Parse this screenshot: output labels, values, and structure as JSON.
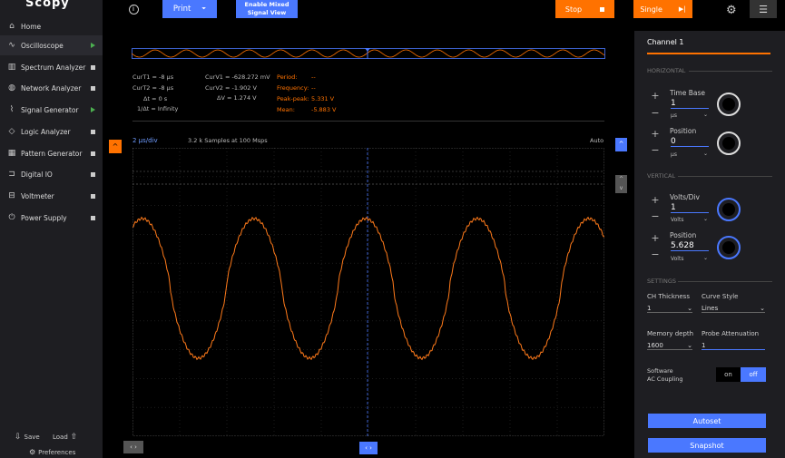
{
  "app": {
    "logo": "Scopy"
  },
  "sidebar": {
    "items": [
      {
        "label": "Home",
        "icon": "home-icon",
        "ind": "none"
      },
      {
        "label": "Oscilloscope",
        "icon": "oscilloscope-icon",
        "ind": "play"
      },
      {
        "label": "Spectrum Analyzer",
        "icon": "spectrum-icon",
        "ind": "square"
      },
      {
        "label": "Network Analyzer",
        "icon": "network-icon",
        "ind": "square"
      },
      {
        "label": "Signal Generator",
        "icon": "signal-icon",
        "ind": "play"
      },
      {
        "label": "Logic Analyzer",
        "icon": "logic-icon",
        "ind": "square"
      },
      {
        "label": "Pattern Generator",
        "icon": "pattern-icon",
        "ind": "square"
      },
      {
        "label": "Digital IO",
        "icon": "digital-io-icon",
        "ind": "square"
      },
      {
        "label": "Voltmeter",
        "icon": "voltmeter-icon",
        "ind": "square"
      },
      {
        "label": "Power Supply",
        "icon": "power-icon",
        "ind": "square"
      }
    ],
    "save_label": "Save",
    "load_label": "Load",
    "preferences_label": "Preferences"
  },
  "toolbar": {
    "info_icon": "info-icon",
    "print_label": "Print",
    "mixed_label_1": "Enable Mixed",
    "mixed_label_2": "Signal View",
    "stop_label": "Stop",
    "single_label": "Single",
    "settings_icon": "gear-icon",
    "menu_icon": "menu-icon"
  },
  "cursors": {
    "curT1": "CurT1 = -8 µs",
    "curT2": "CurT2 = -8 µs",
    "deltaT": "Δt = 0 s",
    "invDeltaT": "1/Δt = Infinity",
    "curV1": "CurV1 = -628.272 mV",
    "curV2": "CurV2 = -1.902 V",
    "deltaV": "ΔV = 1.274 V"
  },
  "measurements": {
    "period_label": "Period:",
    "period_value": "--",
    "frequency_label": "Frequency:",
    "frequency_value": "--",
    "peak_label": "Peak-peak:",
    "peak_value": "5.331 V",
    "mean_label": "Mean:",
    "mean_value": "-5.883 V"
  },
  "plot": {
    "timebase_label": "2 µs/div",
    "samples_label": "3.2 k Samples at 100 Msps",
    "trigger_mode": "Auto"
  },
  "right_panel": {
    "channel_title": "Channel 1",
    "horizontal_section": "HORIZONTAL",
    "time_base_label": "Time Base",
    "time_base_value": "1",
    "time_base_unit": "µs",
    "h_position_label": "Position",
    "h_position_value": "0",
    "h_position_unit": "µs",
    "vertical_section": "VERTICAL",
    "volts_div_label": "Volts/Div",
    "volts_div_value": "1",
    "volts_div_unit": "Volts",
    "v_position_label": "Position",
    "v_position_value": "5.628",
    "v_position_unit": "Volts",
    "settings_section": "SETTINGS",
    "thickness_label": "CH Thickness",
    "thickness_value": "1",
    "curve_style_label": "Curve Style",
    "curve_style_value": "Lines",
    "memory_label": "Memory depth",
    "memory_value": "1600",
    "probe_label": "Probe Attenuation",
    "probe_value": "1",
    "ac_label_1": "Software",
    "ac_label_2": "AC Coupling",
    "on_label": "on",
    "off_label": "off",
    "autoset_label": "Autoset",
    "snapshot_label": "Snapshot"
  },
  "colors": {
    "accent_blue": "#4a78ff",
    "accent_orange": "#ff7200",
    "trace": "#ff7a1a"
  }
}
